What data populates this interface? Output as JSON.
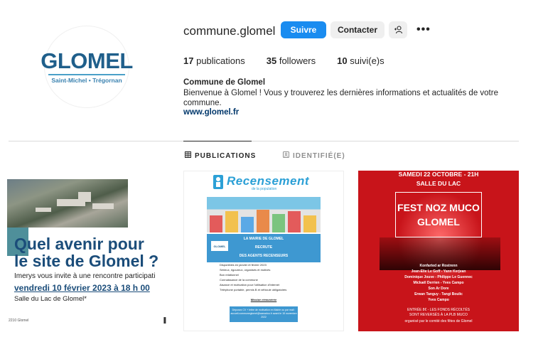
{
  "profile": {
    "avatar": {
      "logo_main": "GLOMEL",
      "logo_sub": "Saint-Michel • Trégornan"
    },
    "username": "commune.glomel",
    "actions": {
      "follow_label": "Suivre",
      "contact_label": "Contacter",
      "add_user_icon": "add-user-icon",
      "more_icon": "more-icon"
    },
    "stats": [
      {
        "count": "17",
        "label": "publications"
      },
      {
        "count": "35",
        "label": "followers"
      },
      {
        "count": "10",
        "label": "suivi(e)s"
      }
    ],
    "bio": {
      "name": "Commune de Glomel",
      "text": "Bienvenue à Glomel ! Vous y trouverez les dernières informations et actualités de votre commune.",
      "link": "www.glomel.fr"
    }
  },
  "tabs": [
    {
      "label": "PUBLICATIONS",
      "icon": "grid-icon",
      "active": true
    },
    {
      "label": "IDENTIFIÉ(E)",
      "icon": "tagged-icon",
      "active": false
    }
  ],
  "posts": [
    {
      "line1": "Quel avenir pour",
      "line2": "le site de Glomel ?",
      "invite": "Imerys vous invite à une rencontre participati",
      "date": "vendredi 10 février 2023 à 18 h 00",
      "place": "Salle du Lac de Glomel*",
      "footer": "2210 Glomel",
      "pause_icon": "pause-icon"
    },
    {
      "title": "Recensement",
      "subtitle": "de la population",
      "box_line1": "LA MAIRIE DE GLOMEL",
      "box_line2": "RECRUTE",
      "box_line3": "DES AGENTS RECENSEURS",
      "logo": "GLOMEL",
      "requirements": [
        "Disponibles en janvier et février 2023",
        "Sérieux, rigoureux, organisés et motivés",
        "Bon relationnel",
        "Connaissance de la commune",
        "Aisance et motivation pour l'utilisation d'internet",
        "Téléphone portable, permis B et véhicule obligatoires"
      ],
      "mission": "Mission rémunérée",
      "contact": "Déposez CV + lettre de motivation en Mairie ou par mail : accueil.communeglomel@wanadoo.fr avant le 15 novembre 2022"
    },
    {
      "date": "SAMEDI 22 OCTOBRE - 21H",
      "place": "SALLE DU LAC",
      "title1": "FEST NOZ MUCO",
      "title2": "GLOMEL",
      "artists": [
        "Konfarted ar Rostrenn",
        "Jean-Elie Le Goff - Yann Kerjean",
        "Dominique Jouve - Philippe Le Guennec",
        "Mickaël Derrien - Yves Campo",
        "Son Ar Dore",
        "Erwan Tanguy - Tangi Boulic",
        "Yves Campo"
      ],
      "footer1": "ENTRÉE 8€ - LES FONDS RÉCOLTÉS",
      "footer2": "SONT REVERSÉS À LA PLB MUCO",
      "footer3": "organisé par le comité des fêtes de Glomel"
    }
  ],
  "colors": {
    "accent": "#1a8cf0",
    "brand": "#1f5f8b",
    "poster_red": "#c8141a"
  }
}
